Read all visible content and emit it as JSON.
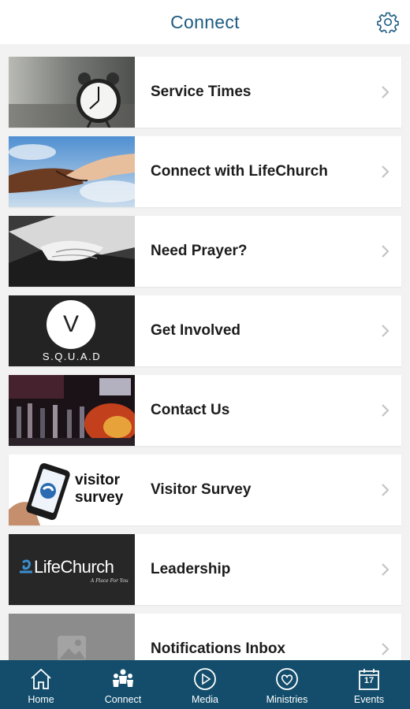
{
  "header": {
    "title": "Connect",
    "settings_icon": "gear-icon"
  },
  "items": [
    {
      "label": "Service Times",
      "thumb": "alarm-clock-photo"
    },
    {
      "label": "Connect with LifeChurch",
      "thumb": "handshake-photo"
    },
    {
      "label": "Need Prayer?",
      "thumb": "praying-hands-photo"
    },
    {
      "label": "Get Involved",
      "thumb": "squad-logo",
      "thumb_text": {
        "letter": "V",
        "caption": "S.Q.U.A.D"
      }
    },
    {
      "label": "Contact Us",
      "thumb": "worship-stage-photo"
    },
    {
      "label": "Visitor Survey",
      "thumb": "visitor-survey-graphic",
      "thumb_text": {
        "line1": "visitor",
        "line2": "survey"
      }
    },
    {
      "label": "Leadership",
      "thumb": "lifechurch-logo",
      "thumb_text": {
        "brand": "LifeChurch",
        "tagline": "A Place For You"
      }
    },
    {
      "label": "Notifications Inbox",
      "thumb": "image-placeholder-icon"
    }
  ],
  "tabbar": {
    "tabs": [
      {
        "label": "Home",
        "icon": "home-icon"
      },
      {
        "label": "Connect",
        "icon": "people-icon"
      },
      {
        "label": "Media",
        "icon": "play-icon"
      },
      {
        "label": "Ministries",
        "icon": "heart-icon"
      },
      {
        "label": "Events",
        "icon": "calendar-icon",
        "icon_text": "17"
      }
    ]
  },
  "colors": {
    "accent": "#1e5c82",
    "tabbar": "#134d6b",
    "background": "#f2f2f2"
  }
}
